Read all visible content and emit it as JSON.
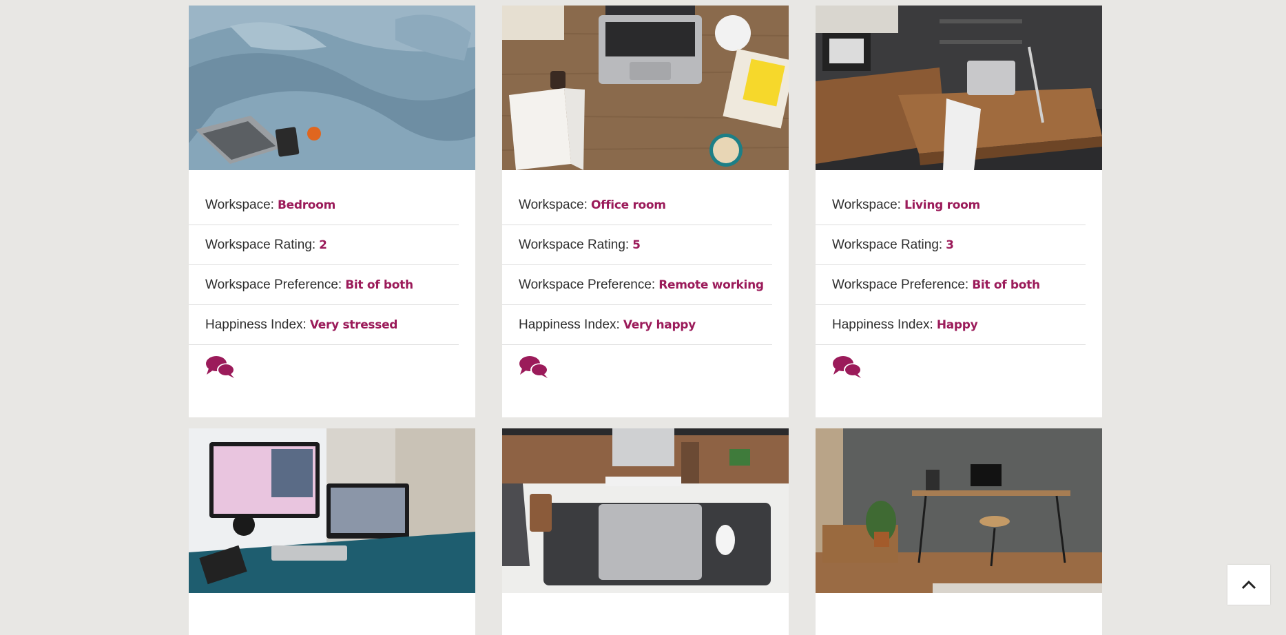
{
  "cards": [
    {
      "workspace_label": "Workspace:",
      "workspace": "Bedroom",
      "rating_label": "Workspace Rating:",
      "rating": "2",
      "preference_label": "Workspace Preference:",
      "preference": "Bit of both",
      "happiness_label": "Happiness Index:",
      "happiness": "Very stressed",
      "photo": "bedroom-laptop-on-bed"
    },
    {
      "workspace_label": "Workspace:",
      "workspace": "Office room",
      "rating_label": "Workspace Rating:",
      "rating": "5",
      "preference_label": "Workspace Preference:",
      "preference": "Remote working",
      "happiness_label": "Happiness Index:",
      "happiness": "Very happy",
      "photo": "wooden-desk-laptop-coffee"
    },
    {
      "workspace_label": "Workspace:",
      "workspace": "Living room",
      "rating_label": "Workspace Rating:",
      "rating": "3",
      "preference_label": "Workspace Preference:",
      "preference": "Bit of both",
      "happiness_label": "Happiness Index:",
      "happiness": "Happy",
      "photo": "pallet-desk-loft-office"
    },
    {
      "photo": "teal-desk-video-call"
    },
    {
      "photo": "white-desk-macbook-felt-mat"
    },
    {
      "photo": "grey-wall-desk-plants"
    }
  ],
  "colors": {
    "accent": "#9b1b5a",
    "page_bg": "#e8e7e4"
  },
  "icons": {
    "comment": "comments-icon",
    "back_to_top": "chevron-up-icon"
  }
}
